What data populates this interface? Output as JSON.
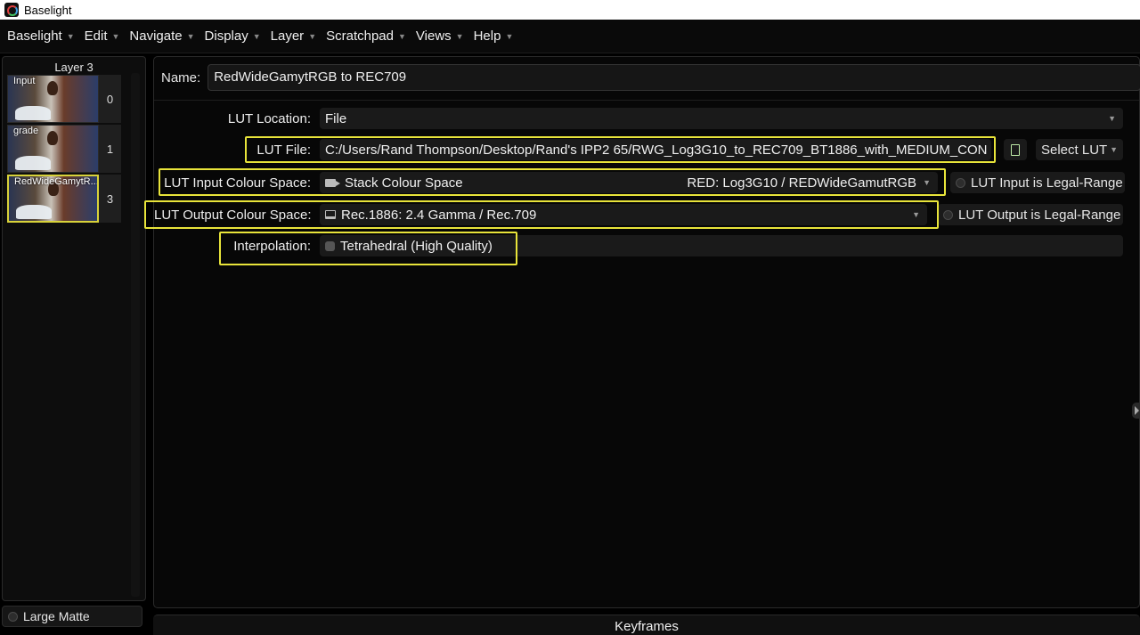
{
  "window": {
    "title": "Baselight"
  },
  "menu": [
    {
      "label": "Baselight"
    },
    {
      "label": "Edit"
    },
    {
      "label": "Navigate"
    },
    {
      "label": "Display"
    },
    {
      "label": "Layer"
    },
    {
      "label": "Scratchpad"
    },
    {
      "label": "Views"
    },
    {
      "label": "Help"
    }
  ],
  "layers_panel": {
    "title": "Layer 3",
    "layers": [
      {
        "label": "Input",
        "number": "0",
        "selected": false
      },
      {
        "label": "grade",
        "number": "1",
        "selected": false
      },
      {
        "label": "RedWideGamytR...",
        "number": "3",
        "selected": true
      }
    ],
    "large_matte_label": "Large Matte"
  },
  "form": {
    "name_label": "Name:",
    "name_value": "RedWideGamytRGB to REC709",
    "lut_location_label": "LUT Location:",
    "lut_location_value": "File",
    "lut_file_label": "LUT File:",
    "lut_file_value": "C:/Users/Rand Thompson/Desktop/Rand's IPP2 65/RWG_Log3G10_to_REC709_BT1886_with_MEDIUM_CON",
    "select_lut_label": "Select LUT",
    "input_cs_label": "LUT Input Colour Space:",
    "input_cs_value": "Stack Colour Space",
    "input_cs_detail": "RED: Log3G10 / REDWideGamutRGB",
    "input_legal_label": "LUT Input is Legal-Range",
    "output_cs_label": "LUT Output Colour Space:",
    "output_cs_value": "Rec.1886: 2.4 Gamma / Rec.709",
    "output_legal_label": "LUT Output is Legal-Range",
    "interpolation_label": "Interpolation:",
    "interpolation_value": "Tetrahedral (High Quality)"
  },
  "keyframes": {
    "title": "Keyframes"
  },
  "colors": {
    "highlight": "#e8e43a",
    "background": "#070707"
  },
  "icons": {
    "file": "document-icon",
    "input_cs": "camera-icon",
    "output_cs": "monitor-icon",
    "interpolation": "interpolation-icon",
    "dropdown": "chevron-down-icon"
  }
}
